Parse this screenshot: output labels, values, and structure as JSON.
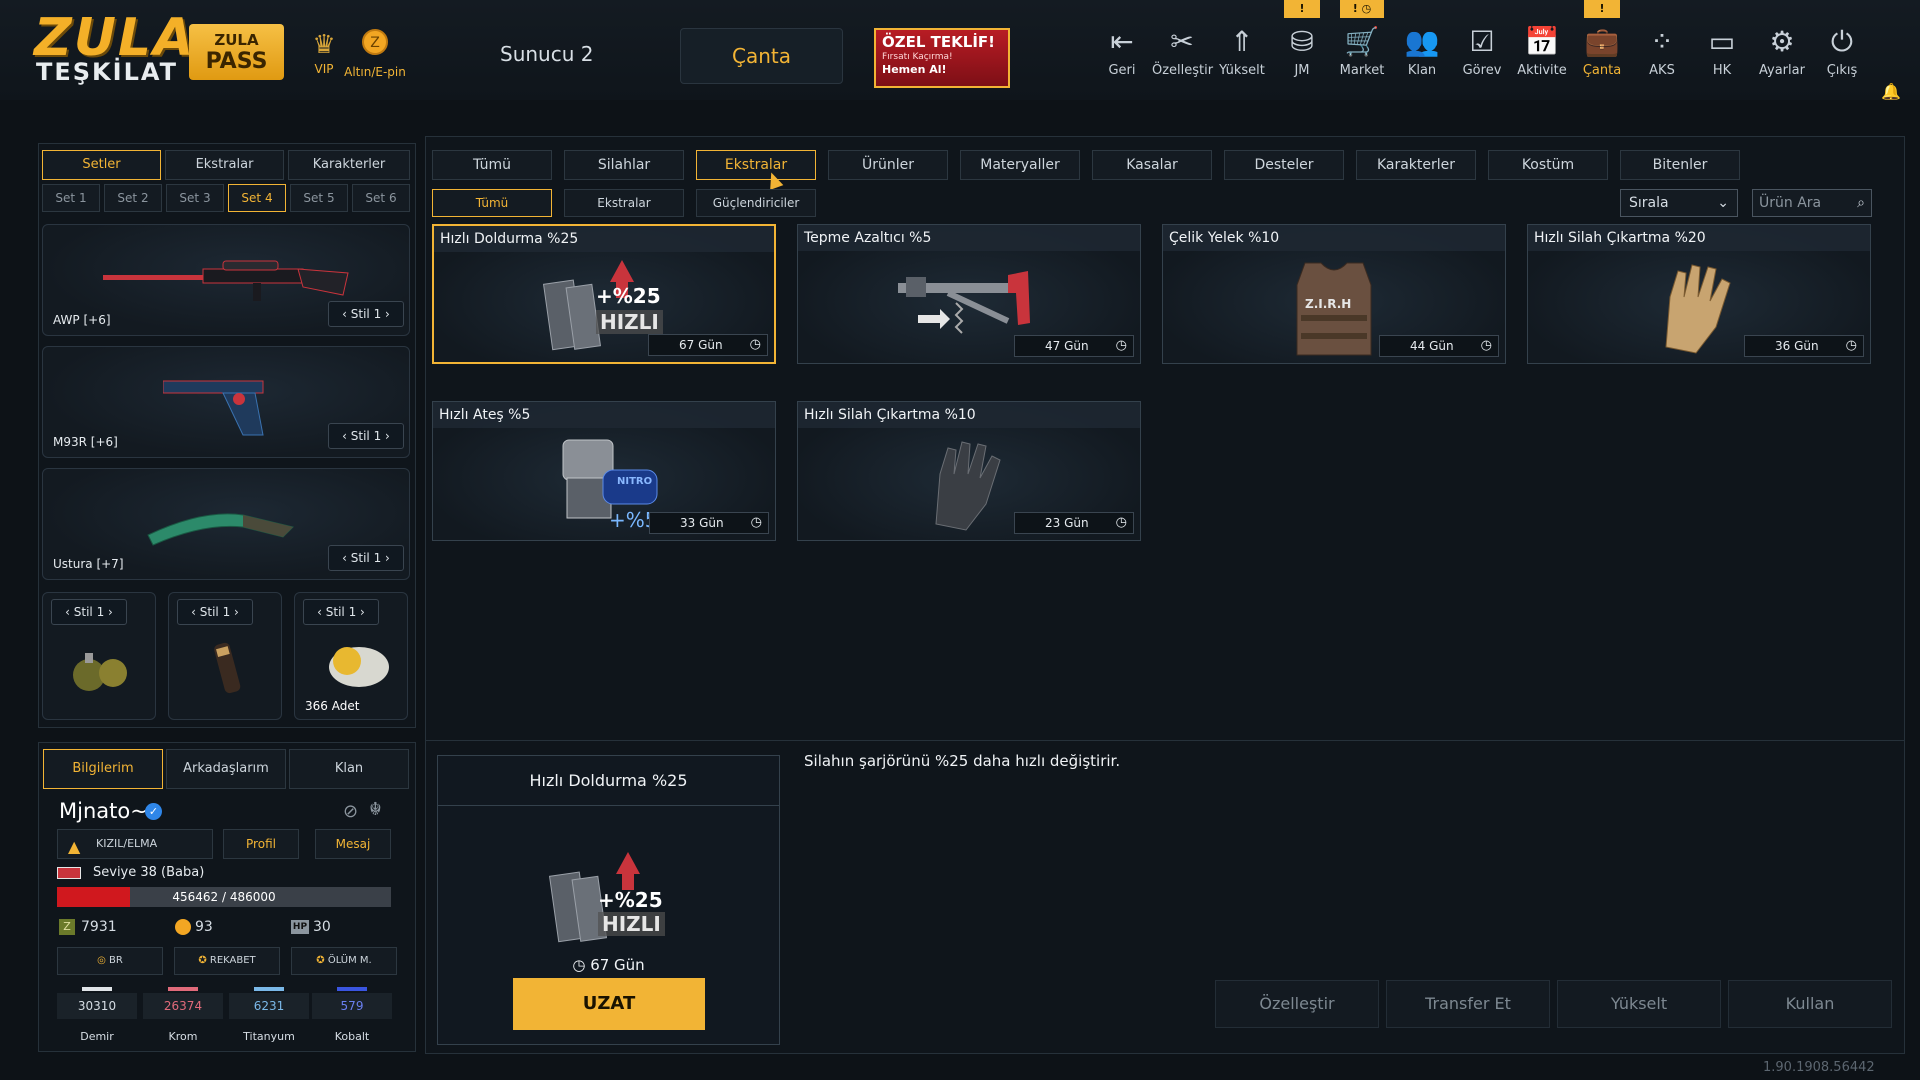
{
  "header": {
    "logo_line1": "ZULA",
    "logo_line2": "TEŞKİLAT",
    "pass_line1": "ZULA",
    "pass_line2": "PASS",
    "vip_label": "VIP",
    "gold_label": "Altın/E-pin",
    "server": "Sunucu 2",
    "bag_button": "Çanta",
    "offer": {
      "title": "ÖZEL TEKLİF!",
      "subtitle": "Fırsatı Kaçırma!",
      "cta": "Hemen Al!"
    },
    "nav": [
      {
        "label": "Geri",
        "icon": "back-icon",
        "badge": ""
      },
      {
        "label": "Özelleştir",
        "icon": "tools-icon",
        "badge": ""
      },
      {
        "label": "Yükselt",
        "icon": "upgrade-icon",
        "badge": ""
      },
      {
        "label": "JM",
        "icon": "coins-icon",
        "badge": "!"
      },
      {
        "label": "Market",
        "icon": "cart-icon",
        "badge": "! ◷"
      },
      {
        "label": "Klan",
        "icon": "clan-icon",
        "badge": ""
      },
      {
        "label": "Görev",
        "icon": "task-icon",
        "badge": ""
      },
      {
        "label": "Aktivite",
        "icon": "calendar-icon",
        "badge": ""
      },
      {
        "label": "Çanta",
        "icon": "bag-icon",
        "badge": "!"
      },
      {
        "label": "AKS",
        "icon": "aks-icon",
        "badge": ""
      },
      {
        "label": "HK",
        "icon": "wallet-icon",
        "badge": ""
      },
      {
        "label": "Ayarlar",
        "icon": "gear-icon",
        "badge": ""
      },
      {
        "label": "Çıkış",
        "icon": "power-icon",
        "badge": ""
      }
    ]
  },
  "left": {
    "tabs": [
      "Setler",
      "Ekstralar",
      "Karakterler"
    ],
    "sets": [
      "Set 1",
      "Set 2",
      "Set 3",
      "Set 4",
      "Set 5",
      "Set 6"
    ],
    "weapons": [
      {
        "name": "AWP [+6]",
        "style": "Stil 1"
      },
      {
        "name": "M93R [+6]",
        "style": "Stil 1"
      },
      {
        "name": "Ustura [+7]",
        "style": "Stil 1"
      }
    ],
    "small": [
      {
        "style": "Stil 1",
        "count": ""
      },
      {
        "style": "Stil 1",
        "count": ""
      },
      {
        "style": "Stil 1",
        "count": "366 Adet"
      }
    ]
  },
  "profile": {
    "tabs": [
      "Bilgilerim",
      "Arkadaşlarım",
      "Klan"
    ],
    "username": "Mjnato~",
    "clan": "KIZIL/ELMA",
    "profile_btn": "Profil",
    "message_btn": "Mesaj",
    "level": "Seviye 38 (Baba)",
    "xp_text": "456462 / 486000",
    "xp_fraction": 0.22,
    "zp": "7931",
    "gold": "93",
    "hp": "30",
    "hp_tag": "HP",
    "modes": [
      "BR",
      "REKABET",
      "ÖLÜM M."
    ],
    "resources": [
      {
        "name": "Demir",
        "value": "30310",
        "color": "#e0e4e8"
      },
      {
        "name": "Krom",
        "value": "26374",
        "color": "#e06a7a"
      },
      {
        "name": "Titanyum",
        "value": "6231",
        "color": "#7ab8e8"
      },
      {
        "name": "Kobalt",
        "value": "579",
        "color": "#3a55e0"
      }
    ]
  },
  "main": {
    "tabs": [
      "Tümü",
      "Silahlar",
      "Ekstralar",
      "Ürünler",
      "Materyaller",
      "Kasalar",
      "Desteler",
      "Karakterler",
      "Kostüm",
      "Bitenler"
    ],
    "subtabs": [
      "Tümü",
      "Ekstralar",
      "Güçlendiriciler"
    ],
    "sort_label": "Sırala",
    "search_placeholder": "Ürün Ara",
    "items": [
      {
        "title": "Hızlı Doldurma %25",
        "days": "67 Gün",
        "badge_top": "+%25",
        "badge_bottom": "HIZLI"
      },
      {
        "title": "Tepme Azaltıcı %5",
        "days": "47 Gün"
      },
      {
        "title": "Çelik Yelek %10",
        "days": "44 Gün",
        "vest_text": "Z.I.R.H"
      },
      {
        "title": "Hızlı Silah Çıkartma %20",
        "days": "36 Gün"
      },
      {
        "title": "Hızlı Ateş %5",
        "days": "33 Gün",
        "badge_top": "NITRO",
        "badge_bottom": "+%5"
      },
      {
        "title": "Hızlı Silah Çıkartma %10",
        "days": "23 Gün"
      }
    ],
    "detail": {
      "title": "Hızlı Doldurma %25",
      "days": "67 Gün",
      "badge_top": "+%25",
      "badge_bottom": "HIZLI",
      "extend_button": "UZAT",
      "description": "Silahın şarjörünü %25 daha hızlı değiştirir."
    },
    "actions": [
      "Özelleştir",
      "Transfer Et",
      "Yükselt",
      "Kullan"
    ]
  },
  "version": "1.90.1908.56442"
}
